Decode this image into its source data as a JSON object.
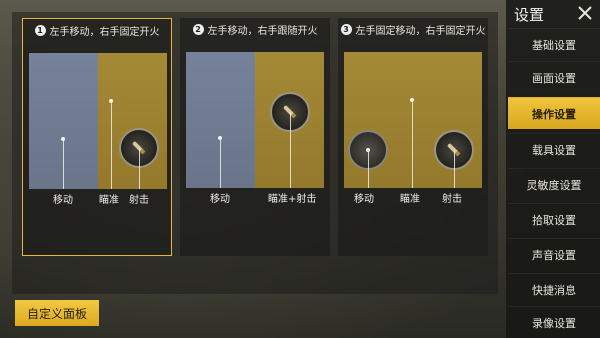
{
  "sidebar": {
    "title": "设置",
    "items": [
      {
        "label": "基础设置"
      },
      {
        "label": "画面设置"
      },
      {
        "label": "操作设置"
      },
      {
        "label": "载具设置"
      },
      {
        "label": "灵敏度设置"
      },
      {
        "label": "拾取设置"
      },
      {
        "label": "声音设置"
      },
      {
        "label": "快捷消息"
      },
      {
        "label": "录像设置"
      }
    ],
    "active_item": "操作设置"
  },
  "modes": [
    {
      "number": "1",
      "title": "左手移动，右手固定开火",
      "labels": [
        "移动",
        "瞄准",
        "射击"
      ],
      "selected": true
    },
    {
      "number": "2",
      "title": "左手移动，右手跟随开火",
      "labels": [
        "移动",
        "瞄准+射击"
      ],
      "selected": false
    },
    {
      "number": "3",
      "title": "左手固定移动，右手固定开火",
      "labels": [
        "移动",
        "瞄准",
        "射击"
      ],
      "selected": false
    }
  ],
  "custom_panel_button": "自定义面板",
  "colors": {
    "accent": "#e6b82d",
    "blue_zone": "#76829a",
    "gold_zone": "#a48936"
  },
  "icons": [
    "close-icon",
    "bullet-icon"
  ]
}
